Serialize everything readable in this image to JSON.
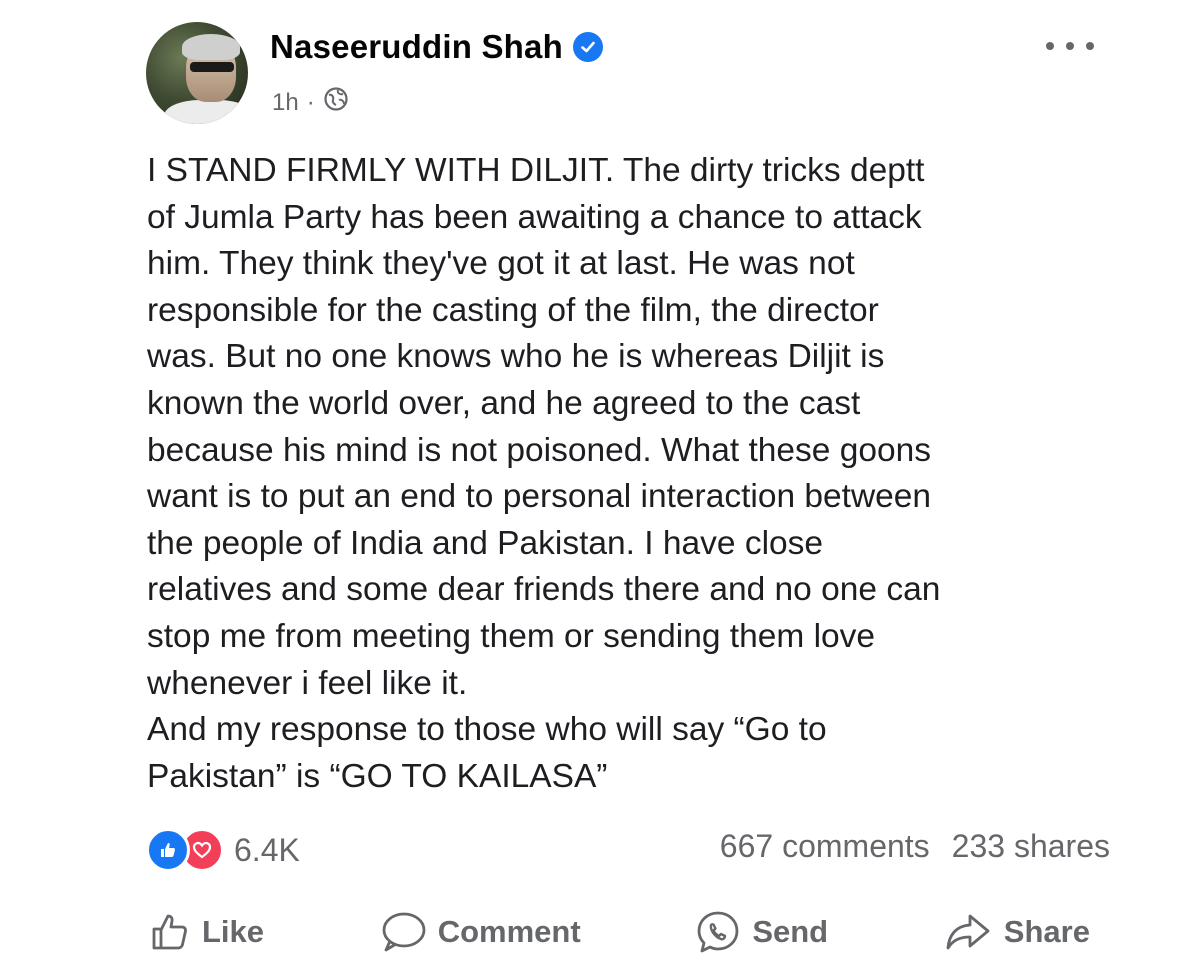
{
  "post": {
    "author": "Naseeruddin Shah",
    "time": "1h",
    "separator": "·",
    "icons": {
      "verified": "verified-badge-icon",
      "audience": "globe-icon",
      "menu": "more-options-icon"
    },
    "text_lines": [
      "I STAND FIRMLY WITH DILJIT. The dirty tricks deptt",
      "of Jumla Party has been awaiting a chance to attack",
      "him. They think they've got it at last. He was not",
      "responsible for the casting of the film, the director",
      "was. But no one knows who he is whereas Diljit is",
      "known the world over, and he agreed to the cast",
      "because his mind is not poisoned. What these goons",
      "want is to put an end to personal interaction between",
      "the people of India and Pakistan. I have close",
      "relatives and some dear friends there and no one can",
      "stop me from meeting them or sending them love",
      "whenever i feel like it.",
      "And my response to  those who will say “Go to",
      "Pakistan” is “GO TO KAILASA”"
    ]
  },
  "engagement": {
    "reaction_count": "6.4K",
    "comments": "667 comments",
    "shares": "233 shares",
    "reaction_colors": {
      "like": "#1877f2",
      "love": "#f33e58"
    }
  },
  "actions": {
    "like": "Like",
    "comment": "Comment",
    "send": "Send",
    "share": "Share"
  },
  "colors": {
    "primary_text": "#1c1e21",
    "secondary_text": "#65676b",
    "brand_blue": "#1877f2"
  }
}
